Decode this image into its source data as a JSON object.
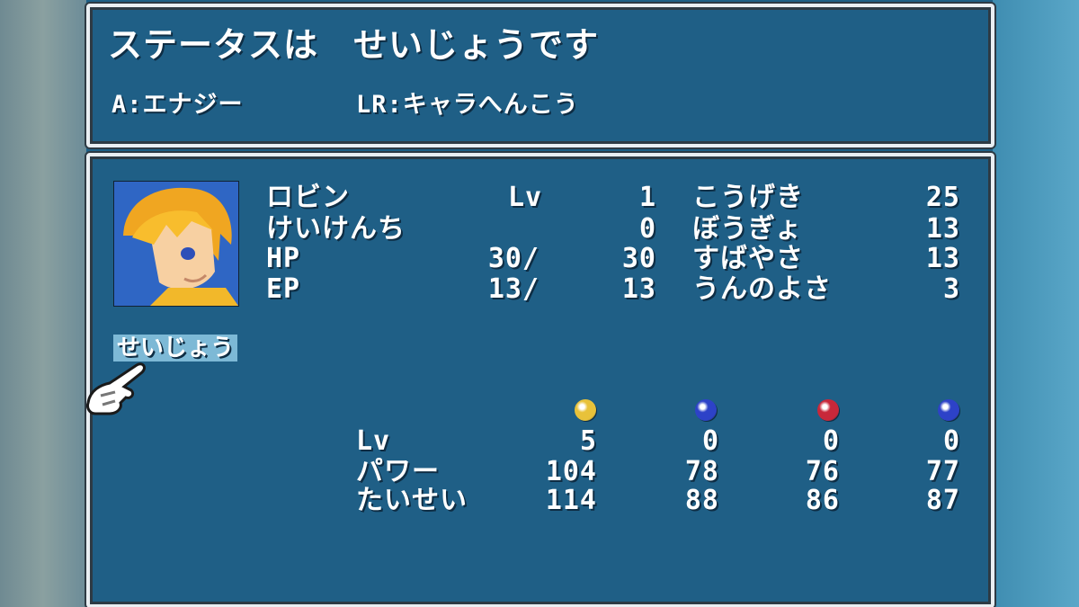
{
  "message": "ステータスは　せいじょうです",
  "help": {
    "a_button": "A:エナジー",
    "lr_button": "LR:キャラへんこう"
  },
  "character": {
    "name": "ロビン",
    "lv_label": "Lv",
    "lv_value": "1",
    "exp_label": "けいけんち",
    "exp_value": "0",
    "hp_label": "HP",
    "hp_current": "30/",
    "hp_max": "30",
    "ep_label": "EP",
    "ep_current": "13/",
    "ep_max": "13",
    "status": "せいじょう"
  },
  "stats": [
    {
      "label": "こうげき",
      "value": "25"
    },
    {
      "label": "ぼうぎょ",
      "value": "13"
    },
    {
      "label": "すばやさ",
      "value": "13"
    },
    {
      "label": "うんのよさ",
      "value": "3"
    }
  ],
  "elements": {
    "colors": [
      "#e8c23a",
      "#2d42c8",
      "#c8283a",
      "#2d42c8"
    ],
    "row_labels": [
      "Lv",
      "パワー",
      "たいせい"
    ],
    "lv": [
      "5",
      "0",
      "0",
      "0"
    ],
    "power": [
      "104",
      "78",
      "76",
      "77"
    ],
    "resist": [
      "114",
      "88",
      "86",
      "87"
    ]
  },
  "icons": {
    "cursor": "pointing-hand-icon",
    "portrait": "character-portrait"
  }
}
